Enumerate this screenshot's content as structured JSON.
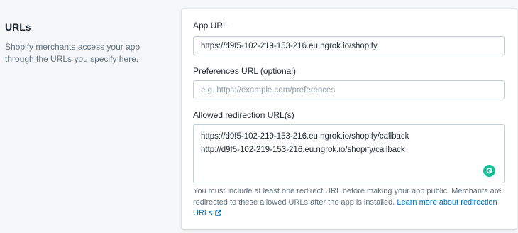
{
  "section": {
    "title": "URLs",
    "description": "Shopify merchants access your app through the URLs you specify here."
  },
  "fields": {
    "app_url": {
      "label": "App URL",
      "value": "https://d9f5-102-219-153-216.eu.ngrok.io/shopify"
    },
    "preferences_url": {
      "label": "Preferences URL (optional)",
      "value": "",
      "placeholder": "e.g. https://example.com/preferences"
    },
    "redirection_urls": {
      "label": "Allowed redirection URL(s)",
      "lines": [
        "https://d9f5-102-219-153-216.eu.ngrok.io/shopify/callback",
        "http://d9f5-102-219-153-216.eu.ngrok.io/shopify/callback"
      ],
      "help_text": "You must include at least one redirect URL before making your app public. Merchants are redirected to these allowed URLs after the app is installed. ",
      "help_link": "Learn more about redirection URLs"
    }
  },
  "icons": {
    "grammarly": "grammarly-icon",
    "external_link": "external-link-icon"
  },
  "colors": {
    "link": "#006fbb",
    "grammarly": "#15c39a",
    "background": "#f4f6f8"
  }
}
